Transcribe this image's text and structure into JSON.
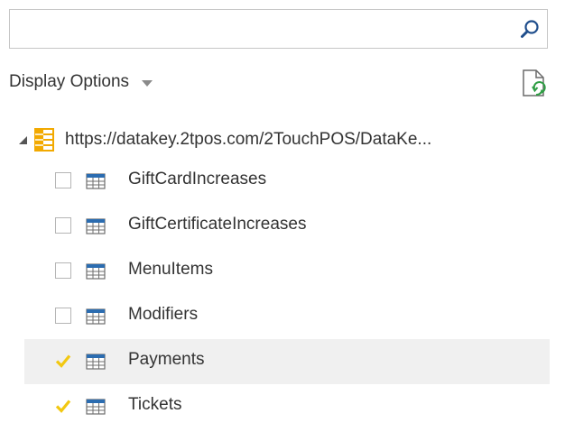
{
  "search": {
    "value": "",
    "placeholder": ""
  },
  "display_options": {
    "label": "Display Options"
  },
  "tree": {
    "root_label": "https://datakey.2tpos.com/2TouchPOS/DataKe...",
    "tables": [
      {
        "label": "GiftCardIncreases",
        "checked": false
      },
      {
        "label": "GiftCertificateIncreases",
        "checked": false
      },
      {
        "label": "MenuItems",
        "checked": false
      },
      {
        "label": "Modifiers",
        "checked": false
      },
      {
        "label": "Payments",
        "checked": true
      },
      {
        "label": "Tickets",
        "checked": true
      }
    ]
  },
  "colors": {
    "accent_check": "#f2c811",
    "table_icon": "#2b6cb0",
    "source_icon": "#f2a900",
    "hover_row": "#f0f0f0"
  }
}
